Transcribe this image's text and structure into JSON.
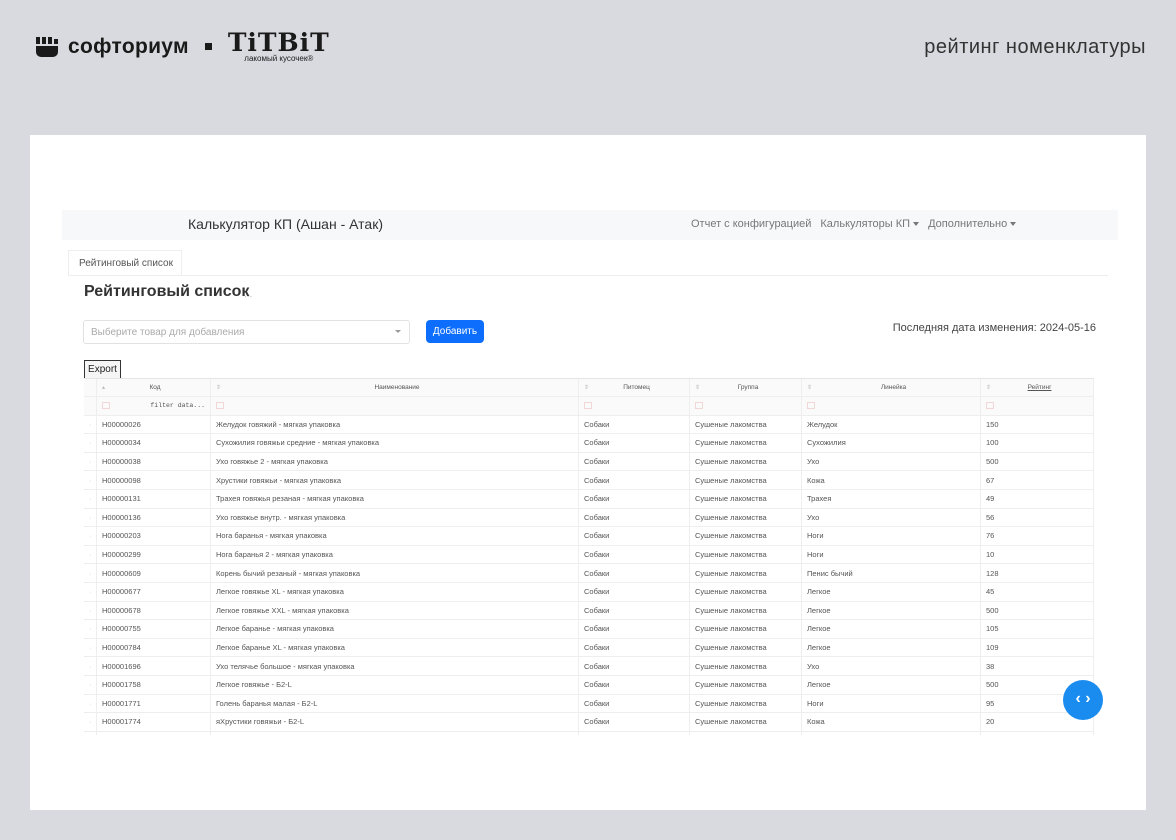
{
  "branding": {
    "company": "софториум",
    "partner": "TiTBiT",
    "partner_tagline": "лакомый кусочек®",
    "page_label": "рейтинг номенклатуры"
  },
  "navbar": {
    "title": "Калькулятор КП (Ашан - Атак)",
    "links": [
      "Отчет с конфигурацией",
      "Калькуляторы КП",
      "Дополнительно"
    ]
  },
  "tab": "Рейтинговый список",
  "heading": "Рейтинговый список",
  "heading_extra": "...",
  "select_placeholder": "Выберите товар для добавления",
  "add_button": "Добавить",
  "last_change": "Последняя дата изменения: 2024-05-16",
  "export_button": "Export",
  "table": {
    "headers": [
      "Код",
      "Наименование",
      "Питомец",
      "Группа",
      "Линейка",
      "Рейтинг"
    ],
    "filter_placeholder": "filter data...",
    "rows": [
      [
        "Н00000026",
        "Желудок говяжий - мягкая упаковка",
        "Собаки",
        "Сушеные лакомства",
        "Желудок",
        "150"
      ],
      [
        "Н00000034",
        "Сухожилия говяжьи средние - мягкая упаковка",
        "Собаки",
        "Сушеные лакомства",
        "Сухожилия",
        "100"
      ],
      [
        "Н00000038",
        "Ухо говяжье 2 - мягкая упаковка",
        "Собаки",
        "Сушеные лакомства",
        "Ухо",
        "500"
      ],
      [
        "Н00000098",
        "Хрустики говяжьи - мягкая упаковка",
        "Собаки",
        "Сушеные лакомства",
        "Кожа",
        "67"
      ],
      [
        "Н00000131",
        "Трахея говяжья резаная - мягкая упаковка",
        "Собаки",
        "Сушеные лакомства",
        "Трахея",
        "49"
      ],
      [
        "Н00000136",
        "Ухо говяжье внутр. - мягкая упаковка",
        "Собаки",
        "Сушеные лакомства",
        "Ухо",
        "56"
      ],
      [
        "Н00000203",
        "Нога баранья - мягкая упаковка",
        "Собаки",
        "Сушеные лакомства",
        "Ноги",
        "76"
      ],
      [
        "Н00000299",
        "Нога баранья 2 - мягкая упаковка",
        "Собаки",
        "Сушеные лакомства",
        "Ноги",
        "10"
      ],
      [
        "Н00000609",
        "Корень бычий резаный - мягкая упаковка",
        "Собаки",
        "Сушеные лакомства",
        "Пенис бычий",
        "128"
      ],
      [
        "Н00000677",
        "Легкое говяжье XL - мягкая упаковка",
        "Собаки",
        "Сушеные лакомства",
        "Легкое",
        "45"
      ],
      [
        "Н00000678",
        "Легкое говяжье XXL - мягкая упаковка",
        "Собаки",
        "Сушеные лакомства",
        "Легкое",
        "500"
      ],
      [
        "Н00000755",
        "Легкое баранье - мягкая упаковка",
        "Собаки",
        "Сушеные лакомства",
        "Легкое",
        "105"
      ],
      [
        "Н00000784",
        "Легкое баранье XL - мягкая упаковка",
        "Собаки",
        "Сушеные лакомства",
        "Легкое",
        "109"
      ],
      [
        "Н00001696",
        "Ухо телячье большое - мягкая упаковка",
        "Собаки",
        "Сушеные лакомства",
        "Ухо",
        "38"
      ],
      [
        "Н00001758",
        "Легкое говяжье - Б2-L",
        "Собаки",
        "Сушеные лакомства",
        "Легкое",
        "500"
      ],
      [
        "Н00001771",
        "Голень баранья малая - Б2-L",
        "Собаки",
        "Сушеные лакомства",
        "Ноги",
        "95"
      ],
      [
        "Н00001774",
        "яХрустики говяжьи - Б2-L",
        "Собаки",
        "Сушеные лакомства",
        "Кожа",
        "20"
      ]
    ]
  },
  "fab_label": "‹ ›"
}
